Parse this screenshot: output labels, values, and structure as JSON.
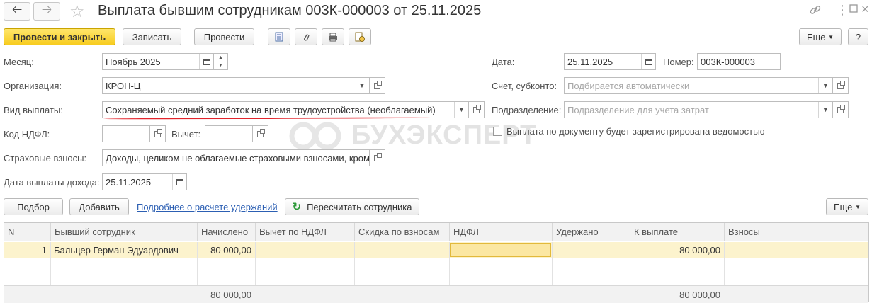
{
  "header": {
    "title": "Выплата бывшим сотрудникам 003К-000003 от 25.11.2025",
    "back_icon": "arrow-left-icon",
    "forward_icon": "arrow-right-icon",
    "favorite_icon": "star-icon",
    "link_icon": "link-icon",
    "more_icon": "more-vertical-icon",
    "maximize_icon": "maximize-icon",
    "close_icon": "close-icon"
  },
  "toolbar": {
    "post_close": "Провести и закрыть",
    "save": "Записать",
    "post": "Провести",
    "more": "Еще",
    "help": "?",
    "icons": [
      "document-icon",
      "paperclip-icon",
      "print-icon",
      "report-icon"
    ]
  },
  "form": {
    "month_label": "Месяц:",
    "month_value": "Ноябрь 2025",
    "org_label": "Организация:",
    "org_value": "КРОН-Ц",
    "paytype_label": "Вид выплаты:",
    "paytype_value": "Сохраняемый средний заработок на время трудоустройства (необлагаемый)",
    "ndfl_code_label": "Код НДФЛ:",
    "ndfl_code_value": "",
    "deduction_label": "Вычет:",
    "deduction_value": "",
    "insurance_label": "Страховые взносы:",
    "insurance_value": "Доходы, целиком не облагаемые страховыми взносами, кром",
    "income_date_label": "Дата выплаты дохода:",
    "income_date_value": "25.11.2025",
    "date_label": "Дата:",
    "date_value": "25.11.2025",
    "number_label": "Номер:",
    "number_value": "003К-000003",
    "account_label": "Счет, субконто:",
    "account_placeholder": "Подбирается автоматически",
    "division_label": "Подразделение:",
    "division_placeholder": "Подразделение для учета затрат",
    "statement_checkbox_label": "Выплата по документу будет зарегистрирована ведомостью",
    "statement_checked": false
  },
  "watermark": "БУХЭКСПЕРТ",
  "table_toolbar": {
    "pick": "Подбор",
    "add": "Добавить",
    "details_link": "Подробнее о расчете удержаний",
    "recalc": "Пересчитать сотрудника",
    "recalc_icon": "refresh-icon",
    "more": "Еще"
  },
  "table": {
    "columns": [
      "N",
      "Бывший сотрудник",
      "Начислено",
      "Вычет по НДФЛ",
      "Скидка по взносам",
      "НДФЛ",
      "Удержано",
      "К выплате",
      "Взносы"
    ],
    "rows": [
      {
        "n": "1",
        "employee": "Бальцер Герман Эдуардович",
        "accrued": "80 000,00",
        "ndfl_deduction": "",
        "discount": "",
        "ndfl": "",
        "withheld": "",
        "to_pay": "80 000,00",
        "contributions": ""
      }
    ],
    "totals": {
      "accrued": "80 000,00",
      "to_pay": "80 000,00"
    }
  },
  "colors": {
    "primary_button": "#f7cc20",
    "selected_row": "#fcf3cd",
    "active_cell": "#fbe7a2",
    "link": "#2c5fb3",
    "underline": "#e3242b"
  }
}
